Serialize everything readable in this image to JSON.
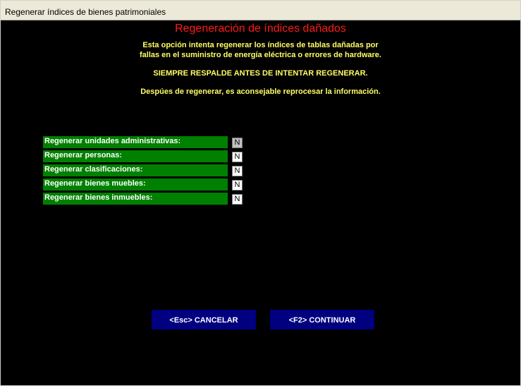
{
  "window": {
    "title": "Regenerar índices de bienes patrimoniales"
  },
  "header": {
    "heading": "Regeneración de índices dañados",
    "info_line1": "Esta opción intenta regenerar los índices de tablas dañadas por",
    "info_line2": "fallas en el suministro de energía eléctrica o errores de hardware.",
    "warning": "SIEMPRE RESPALDE ANTES DE INTENTAR REGENERAR.",
    "note": "Despúes de regenerar, es aconsejable reprocesar la información."
  },
  "options": [
    {
      "label": "Regenerar unidades administrativas:",
      "value": "N"
    },
    {
      "label": "Regenerar personas:",
      "value": "N"
    },
    {
      "label": "Regenerar clasificaciones:",
      "value": "N"
    },
    {
      "label": "Regenerar bienes muebles:",
      "value": "N"
    },
    {
      "label": "Regenerar bienes inmuebles:",
      "value": "N"
    }
  ],
  "buttons": {
    "cancel": "<Esc> CANCELAR",
    "continue": "<F2> CONTINUAR"
  },
  "colors": {
    "heading": "#ff1a1a",
    "info_text": "#ffff66",
    "label_bg": "#008000",
    "button_bg": "#000080",
    "background": "#000000"
  }
}
